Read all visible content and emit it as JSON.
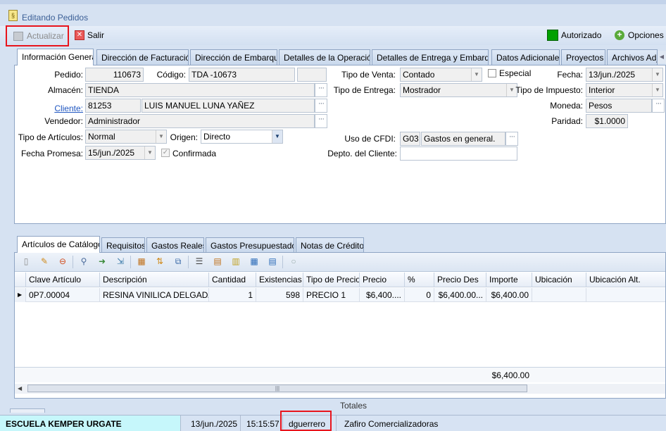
{
  "window": {
    "title": "Editando Pedidos"
  },
  "toolbar": {
    "update_label": "Actualizar",
    "exit_label": "Salir",
    "status_label": "Autorizado",
    "status_color": "#00a000",
    "options_label": "Opciones"
  },
  "tabs": [
    "Información General",
    "Dirección de Facturación",
    "Dirección de Embarque",
    "Detalles de la Operación",
    "Detalles de Entrega y Embarque",
    "Datos Adicionales",
    "Proyectos",
    "Archivos Adju"
  ],
  "form": {
    "pedido_label": "Pedido:",
    "pedido_value": "110673",
    "codigo_label": "Código:",
    "codigo_value": "TDA -10673",
    "almacen_label": "Almacén:",
    "almacen_value": "TIENDA",
    "cliente_label": "Cliente:",
    "cliente_id": "81253",
    "cliente_name": "LUIS MANUEL LUNA YAÑEZ",
    "vendedor_label": "Vendedor:",
    "vendedor_value": "Administrador",
    "tipo_articulos_label": "Tipo de Artículos:",
    "tipo_articulos_value": "Normal",
    "origen_label": "Origen:",
    "origen_value": "Directo",
    "fecha_promesa_label": "Fecha Promesa:",
    "fecha_promesa_value": "15/jun./2025",
    "confirmada_label": "Confirmada",
    "tipo_venta_label": "Tipo de Venta:",
    "tipo_venta_value": "Contado",
    "especial_label": "Especial",
    "tipo_entrega_label": "Tipo de Entrega:",
    "tipo_entrega_value": "Mostrador",
    "uso_cfdi_label": "Uso de CFDI:",
    "uso_cfdi_code": "G03",
    "uso_cfdi_desc": "Gastos en general.",
    "depto_label": "Depto. del Cliente:",
    "depto_value": "",
    "fecha_label": "Fecha:",
    "fecha_value": "13/jun./2025",
    "tipo_impuesto_label": "Tipo de Impuesto:",
    "tipo_impuesto_value": "Interior",
    "moneda_label": "Moneda:",
    "moneda_value": "Pesos",
    "paridad_label": "Paridad:",
    "paridad_value": "$1.0000"
  },
  "bottom_tabs": [
    "Artículos de Catálogo",
    "Requisitos",
    "Gastos Reales",
    "Gastos Presupuestados",
    "Notas de Crédito"
  ],
  "grid": {
    "columns": [
      "Clave Artículo",
      "Descripción",
      "Cantidad",
      "Existencias",
      "Tipo de Precio",
      "Precio",
      "%",
      "Precio Des",
      "Importe",
      "Ubicación",
      "Ubicación Alt."
    ],
    "rows": [
      [
        "0P7.00004",
        "RESINA VINILICA DELGADA...",
        "1",
        "598",
        "PRECIO 1",
        "$6,400....",
        "0",
        "$6,400.00...",
        "$6,400.00",
        "",
        ""
      ]
    ],
    "total": "$6,400.00"
  },
  "totals_label": "Totales",
  "statusbar": {
    "school": "ESCUELA KEMPER URGATE",
    "date": "13/jun./2025",
    "time": "15:15:57",
    "user": "dguerrero",
    "company": "Zafiro Comercializadoras"
  },
  "highlight_color": "#e8141c"
}
